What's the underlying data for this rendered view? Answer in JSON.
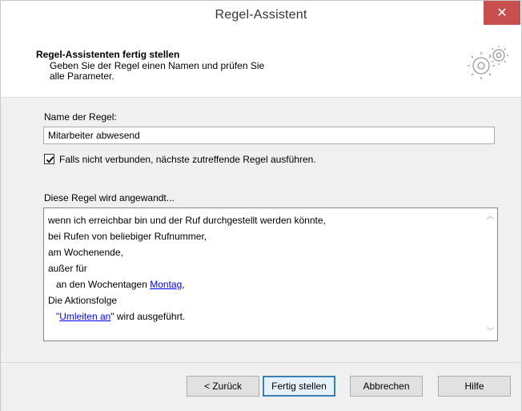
{
  "window": {
    "title": "Regel-Assistent"
  },
  "header": {
    "title": "Regel-Assistenten fertig stellen",
    "description": "Geben Sie der Regel einen Namen und prüfen Sie alle Parameter."
  },
  "form": {
    "name_label": "Name der Regel:",
    "name_value": "Mitarbeiter abwesend",
    "checkbox_label": "Falls nicht verbunden, nächste zutreffende Regel ausführen.",
    "checkbox_checked": true,
    "applied_label": "Diese Regel wird angewandt..."
  },
  "rule": {
    "line1": "wenn ich erreichbar bin und der Ruf durchgestellt werden könnte,",
    "line2": "bei Rufen von beliebiger Rufnummer,",
    "line3": "am Wochenende,",
    "line4": "außer für",
    "line5_prefix": "an den Wochentagen ",
    "line5_link": "Montag",
    "line5_suffix": ",",
    "line6": "Die Aktionsfolge",
    "line7_quote_open": "\"",
    "line7_link": "Umleiten an",
    "line7_suffix": "\" wird ausgeführt."
  },
  "buttons": {
    "back": "< Zurück",
    "finish": "Fertig stellen",
    "cancel": "Abbrechen",
    "help": "Hilfe"
  },
  "icons": {
    "close": "close-icon",
    "header": "gears-icon",
    "check": "checkmark-icon",
    "scroll_up": "chevron-up-icon",
    "scroll_down": "chevron-down-icon"
  },
  "colors": {
    "close_button": "#c7504f",
    "link": "#0000ee",
    "default_button_border": "#3c7fb1"
  }
}
